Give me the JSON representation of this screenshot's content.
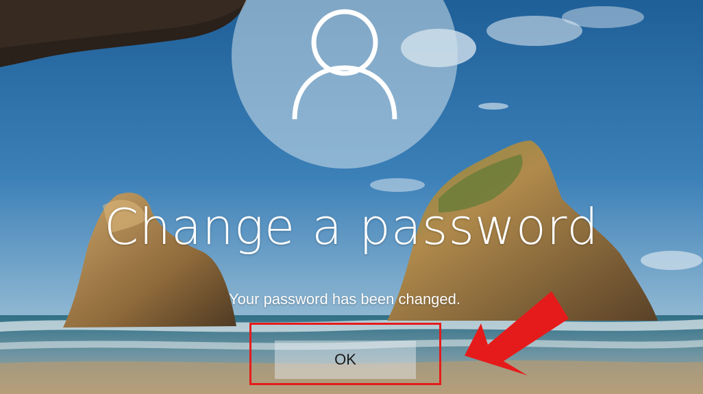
{
  "dialog": {
    "title": "Change a password",
    "message": "Your password has been changed.",
    "ok_label": "OK"
  },
  "colors": {
    "annotation": "#e51b1b",
    "text": "#ffffff"
  },
  "icons": {
    "avatar": "user-silhouette-icon"
  }
}
